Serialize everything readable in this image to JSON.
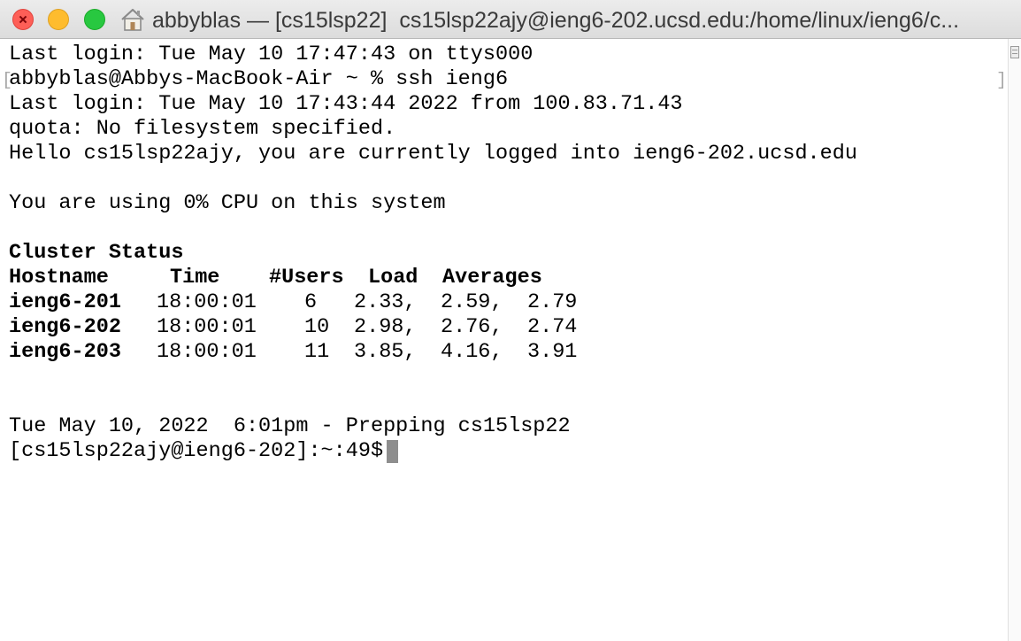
{
  "window": {
    "title": "abbyblas — [cs15lsp22]  cs15lsp22ajy@ieng6-202.ucsd.edu:/home/linux/ieng6/c..."
  },
  "terminal": {
    "lines": {
      "last_login_local": "Last login: Tue May 10 17:47:43 on ttys000",
      "ssh_command": "abbyblas@Abbys-MacBook-Air ~ % ssh ieng6",
      "last_login_remote": "Last login: Tue May 10 17:43:44 2022 from 100.83.71.43",
      "quota": "quota: No filesystem specified.",
      "hello": "Hello cs15lsp22ajy, you are currently logged into ieng6-202.ucsd.edu",
      "cpu_usage": "You are using 0% CPU on this system",
      "date_prep": "Tue May 10, 2022  6:01pm - Prepping cs15lsp22",
      "prompt": "[cs15lsp22ajy@ieng6-202]:~:49$"
    },
    "cluster_status": {
      "heading": "Cluster Status",
      "headers": [
        "Hostname",
        "Time",
        "#Users",
        "Load",
        "Averages"
      ],
      "rows": [
        [
          "ieng6-201",
          "18:00:01",
          "6",
          "2.33,",
          "2.59,",
          "2.79"
        ],
        [
          "ieng6-202",
          "18:00:01",
          "10",
          "2.98,",
          "2.76,",
          "2.74"
        ],
        [
          "ieng6-203",
          "18:00:01",
          "11",
          "3.85,",
          "4.16,",
          "3.91"
        ]
      ]
    }
  },
  "colors": {
    "close": "#fe5f57",
    "minimize": "#febc2e",
    "maximize": "#28c840",
    "cursor": "#8e8e8e"
  },
  "icons": {
    "title_icon": "home-icon",
    "scroll_marker": "bookmark-icon"
  }
}
